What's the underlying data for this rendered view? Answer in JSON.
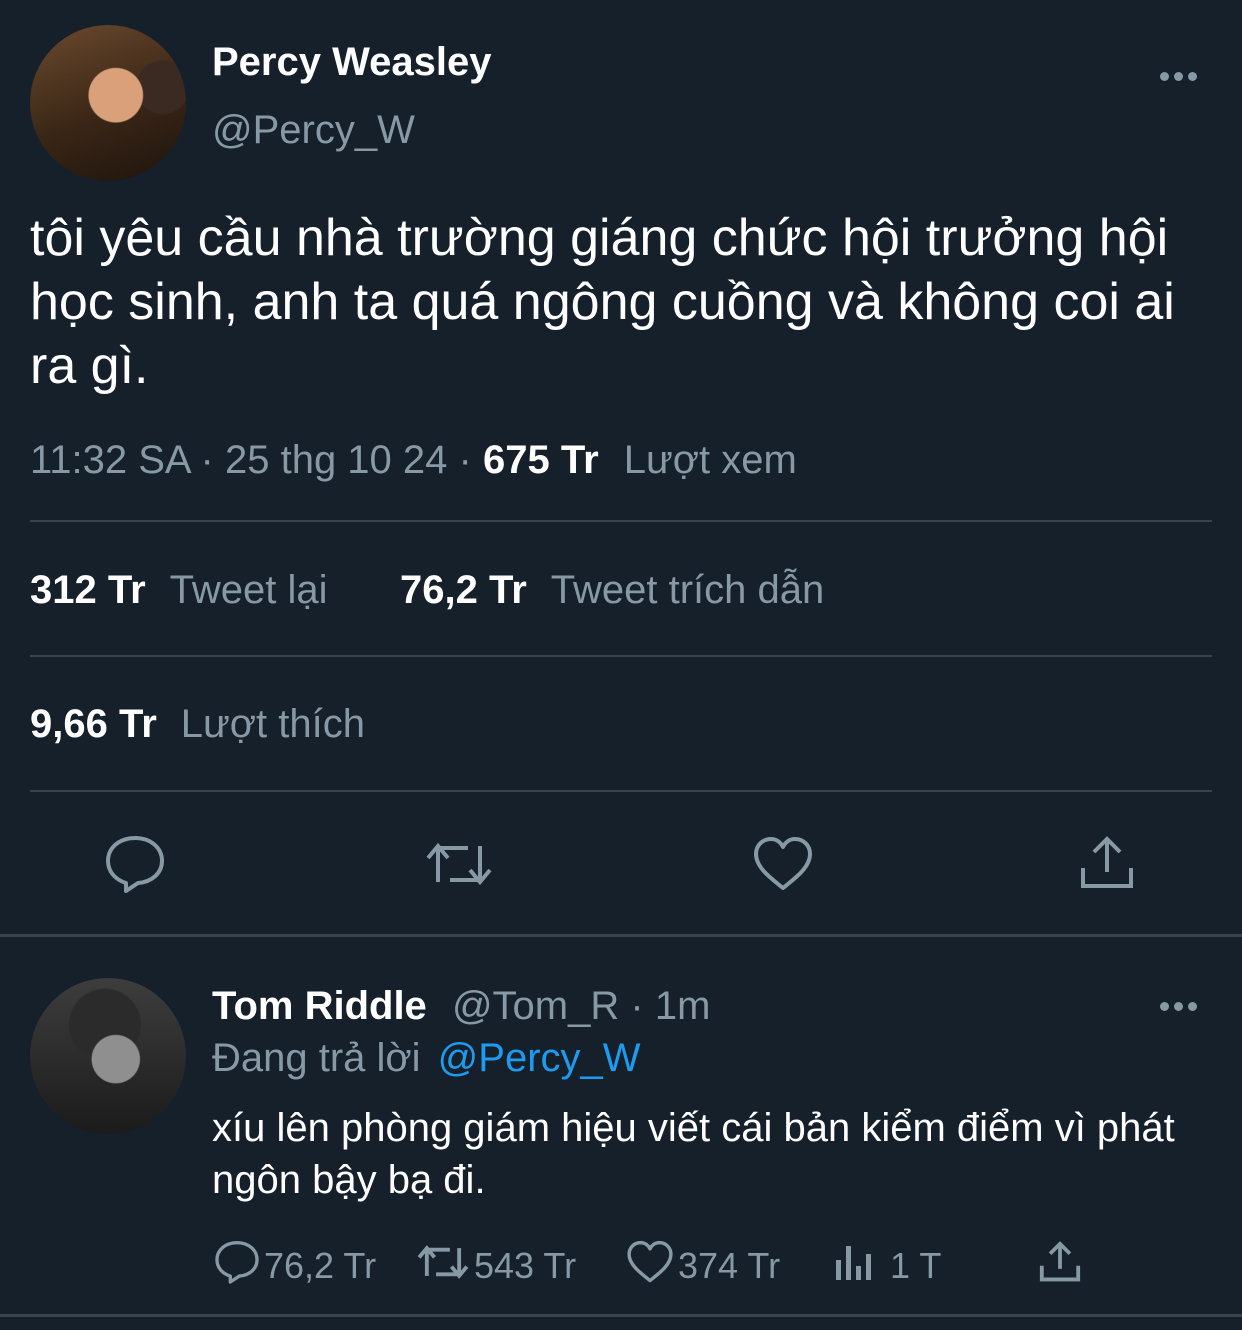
{
  "tweet": {
    "author_name": "Percy Weasley",
    "author_handle": "@Percy_W",
    "text": "tôi yêu cầu nhà trường giáng chức hội trưởng hội học sinh, anh ta quá ngông cuồng và không coi ai ra gì.",
    "time": "11:32 SA",
    "sep1": "·",
    "date": "25 thg 10 24",
    "sep2": "·",
    "views_value": "675 Tr",
    "views_label": "Lượt xem",
    "retweets_value": "312 Tr",
    "retweets_label": "Tweet lại",
    "quotes_value": "76,2 Tr",
    "quotes_label": "Tweet trích dẫn",
    "likes_value": "9,66 Tr",
    "likes_label": "Lượt thích"
  },
  "actions": {
    "icons": [
      "reply-icon",
      "retweet-icon",
      "like-icon",
      "share-icon"
    ]
  },
  "reply": {
    "author_name": "Tom Riddle",
    "author_handle": "@Tom_R",
    "sep": "·",
    "time": "1m",
    "replying_label": "Đang trả lời",
    "replying_to": "@Percy_W",
    "text": "xíu lên phòng giám hiệu viết cái bản kiểm điểm vì phát ngôn bậy bạ đi.",
    "reply_count": "76,2 Tr",
    "retweet_count": "543 Tr",
    "like_count": "374 Tr",
    "view_count": "1 T"
  },
  "colors": {
    "background": "#15202b",
    "divider": "#38444d",
    "muted": "#8899a6",
    "link": "#1d9bf0"
  }
}
